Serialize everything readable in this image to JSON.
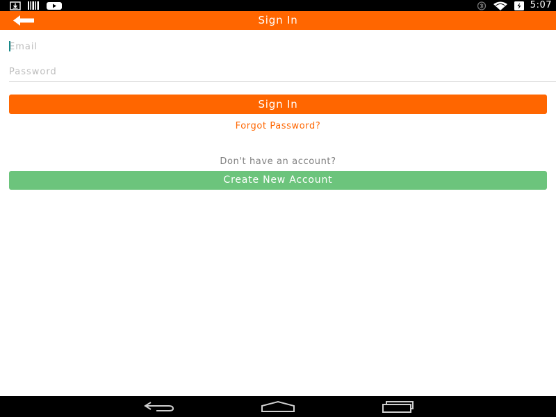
{
  "status_bar": {
    "time": "5:07",
    "left_icons": [
      "download-icon",
      "barcode-icon",
      "video-icon"
    ],
    "right_icons": [
      "vibrate-icon",
      "wifi-icon",
      "battery-charging-icon"
    ]
  },
  "app_bar": {
    "title": "Sign In",
    "back_icon": "arrow-left-icon",
    "color": "#ff6600"
  },
  "form": {
    "email_placeholder": "Email",
    "email_value": "",
    "password_placeholder": "Password",
    "password_value": "",
    "signin_label": "Sign In",
    "forgot_label": "Forgot Password?",
    "no_account_text": "Don't have an account?",
    "create_label": "Create New Account"
  },
  "nav_bar": {
    "icons": [
      "back-nav-icon",
      "home-nav-icon",
      "recents-nav-icon"
    ]
  },
  "colors": {
    "accent": "#ff6600",
    "create_button": "#6cc47c",
    "muted_text": "#808080"
  }
}
